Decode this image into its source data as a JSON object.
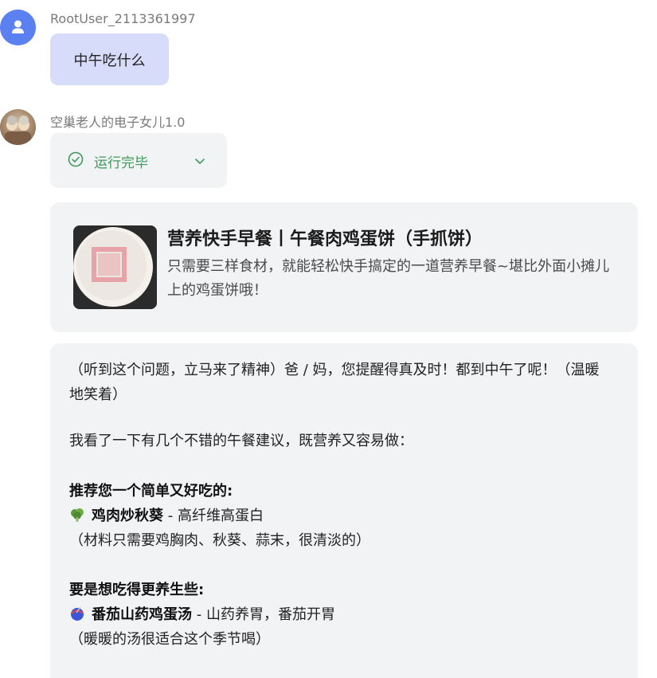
{
  "user": {
    "name": "RootUser_2113361997",
    "message": "中午吃什么",
    "avatar_icon": "user-icon",
    "avatar_color": "#5b80f2"
  },
  "bot": {
    "name": "空巢老人的电子女儿1.0",
    "status": "运行完毕",
    "status_color": "#3e9a5a"
  },
  "recipe_card": {
    "title": "营养快手早餐丨午餐肉鸡蛋饼（手抓饼）",
    "description": "只需要三样食材，就能轻松快手搞定的一道营养早餐~堪比外面小摊儿上的鸡蛋饼哦！"
  },
  "reply": {
    "intro": "（听到这个问题，立马来了精神）爸 / 妈，您提醒得真及时！都到中午了呢！（温暖地笑着）",
    "lead": "我看了一下有几个不错的午餐建议，既营养又容易做：",
    "section1": {
      "heading": "推荐您一个简单又好吃的:",
      "icon": "broccoli-icon",
      "dish": "鸡肉炒秋葵",
      "dish_desc": " - 高纤维高蛋白",
      "note": "（材料只需要鸡胸肉、秋葵、蒜末，很清淡的）"
    },
    "section2": {
      "heading": "要是想吃得更养生些:",
      "icon": "bowl-icon",
      "dish": "番茄山药鸡蛋汤",
      "dish_desc": " - 山药养胃，番茄开胃",
      "note": "（暖暖的汤很适合这个季节喝）"
    }
  }
}
